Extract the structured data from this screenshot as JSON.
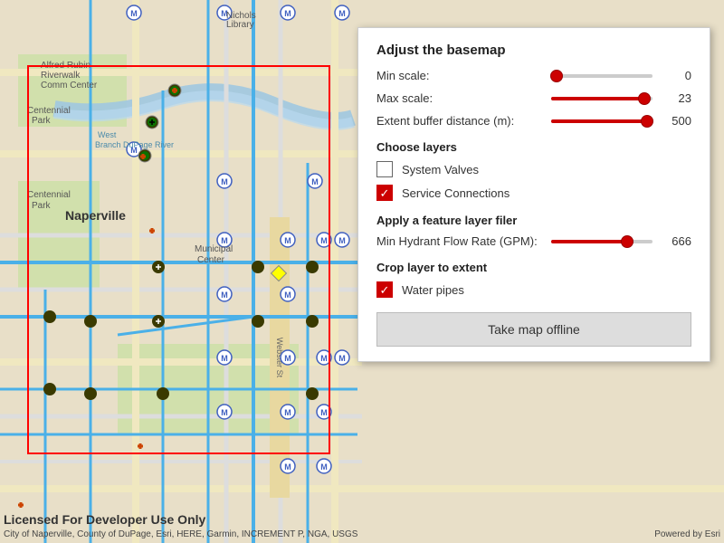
{
  "map": {
    "city_label": "Naperville",
    "developer_text": "Licensed For Developer Use Only",
    "watermark_left": "City of Naperville, County of DuPage, Esri, HERE, Garmin, INCREMENT P, NGA, USGS",
    "watermark_right": "Powered by Esri"
  },
  "panel": {
    "adjust_title": "Adjust the basemap",
    "min_scale_label": "Min scale:",
    "min_scale_value": "0",
    "min_scale_percent": 5,
    "max_scale_label": "Max scale:",
    "max_scale_value": "23",
    "max_scale_percent": 92,
    "extent_label": "Extent buffer distance (m):",
    "extent_value": "500",
    "extent_percent": 95,
    "choose_layers_title": "Choose layers",
    "layer1_label": "System Valves",
    "layer1_checked": false,
    "layer2_label": "Service Connections",
    "layer2_checked": true,
    "feature_filter_title": "Apply a feature layer filer",
    "hydrant_label": "Min Hydrant Flow Rate (GPM):",
    "hydrant_value": "666",
    "hydrant_percent": 75,
    "crop_title": "Crop layer to extent",
    "water_pipes_label": "Water pipes",
    "water_pipes_checked": true,
    "offline_button_label": "Take map offline"
  }
}
